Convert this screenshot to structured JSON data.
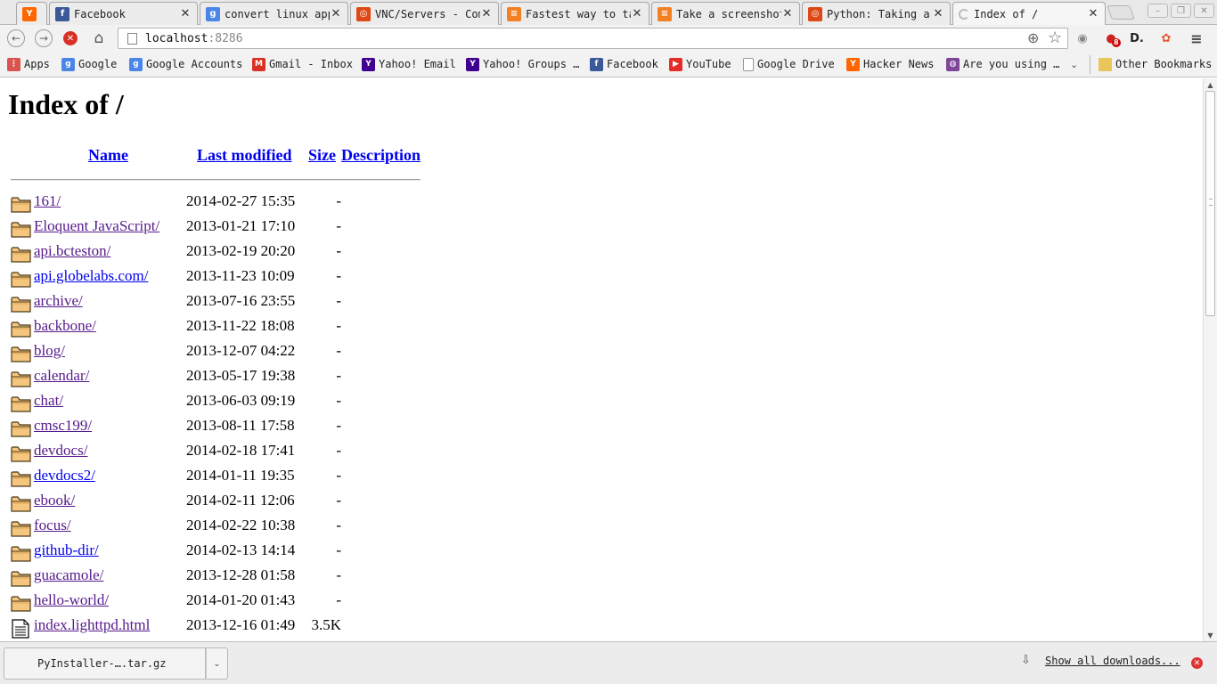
{
  "tabs": [
    {
      "title": "",
      "favicon": "ycombinator-icon",
      "color": "#ff6600",
      "letter": "Y"
    },
    {
      "title": "Facebook",
      "favicon": "facebook-icon",
      "color": "#3b5998",
      "letter": "f"
    },
    {
      "title": "convert linux app",
      "favicon": "google-icon",
      "color": "#4a86e8",
      "letter": "g"
    },
    {
      "title": "VNC/Servers - Com",
      "favicon": "ubuntu-icon",
      "color": "#dd4814",
      "letter": "◎"
    },
    {
      "title": "Fastest way to ta",
      "favicon": "stackoverflow-icon",
      "color": "#f48024",
      "letter": "≡"
    },
    {
      "title": "Take a screenshot",
      "favicon": "stackoverflow-icon",
      "color": "#f48024",
      "letter": "≡"
    },
    {
      "title": "Python: Taking a",
      "favicon": "ubuntu-icon",
      "color": "#dd4814",
      "letter": "◎"
    },
    {
      "title": "Index of /",
      "favicon": "loading-icon",
      "color": "#bbbbbb",
      "letter": ""
    }
  ],
  "toolbar": {
    "back_icon": "back-icon",
    "forward_icon": "forward-icon",
    "stop_icon": "stop-icon",
    "home_icon": "home-icon",
    "url_host": "localhost",
    "url_port": ":8286",
    "menu_icon": "menu-icon"
  },
  "extensions": [
    {
      "name": "globe-extension-icon",
      "glyph": "◉",
      "color": "#888888"
    },
    {
      "name": "notification-extension-icon",
      "glyph": "●",
      "color": "#cc2222",
      "badge": "8"
    },
    {
      "name": "d-extension-icon",
      "glyph": "D.",
      "color": "#222222"
    },
    {
      "name": "wunderlist-extension-icon",
      "glyph": "✿",
      "color": "#e4572e"
    }
  ],
  "bookmarks": [
    {
      "label": "Apps",
      "icon": "apps-icon",
      "color": "#d9534f",
      "letter": "⋮"
    },
    {
      "label": "Google",
      "icon": "google-icon",
      "color": "#4a86e8",
      "letter": "g"
    },
    {
      "label": "Google Accounts",
      "icon": "google-icon",
      "color": "#4a86e8",
      "letter": "g"
    },
    {
      "label": "Gmail - Inbox",
      "icon": "gmail-icon",
      "color": "#d93025",
      "letter": "M"
    },
    {
      "label": "Yahoo! Email",
      "icon": "yahoo-icon",
      "color": "#400191",
      "letter": "Y"
    },
    {
      "label": "Yahoo! Groups …",
      "icon": "yahoo-icon",
      "color": "#400191",
      "letter": "Y"
    },
    {
      "label": "Facebook",
      "icon": "facebook-icon",
      "color": "#3b5998",
      "letter": "f"
    },
    {
      "label": "YouTube",
      "icon": "youtube-icon",
      "color": "#e52d27",
      "letter": "▶"
    },
    {
      "label": "Google Drive",
      "icon": "page-icon",
      "color": "#bdbdbd",
      "letter": ""
    },
    {
      "label": "Hacker News",
      "icon": "ycombinator-icon",
      "color": "#ff6600",
      "letter": "Y"
    },
    {
      "label": "Are you using …",
      "icon": "tor-icon",
      "color": "#7d4698",
      "letter": "◍"
    }
  ],
  "bookmarks_more_icon": "chevron-down-icon",
  "other_bookmarks": "Other Bookmarks",
  "page": {
    "title": "Index of /",
    "headers": {
      "name": "Name",
      "modified": "Last modified",
      "size": "Size",
      "description": "Description"
    },
    "entries": [
      {
        "name": "161/",
        "modified": "2014-02-27 15:35",
        "size": "-",
        "type": "folder",
        "visited": true
      },
      {
        "name": "Eloquent JavaScript/",
        "modified": "2013-01-21 17:10",
        "size": "-",
        "type": "folder",
        "visited": true
      },
      {
        "name": "api.bcteston/",
        "modified": "2013-02-19 20:20",
        "size": "-",
        "type": "folder",
        "visited": true
      },
      {
        "name": "api.globelabs.com/",
        "modified": "2013-11-23 10:09",
        "size": "-",
        "type": "folder",
        "visited": false
      },
      {
        "name": "archive/",
        "modified": "2013-07-16 23:55",
        "size": "-",
        "type": "folder",
        "visited": true
      },
      {
        "name": "backbone/",
        "modified": "2013-11-22 18:08",
        "size": "-",
        "type": "folder",
        "visited": true
      },
      {
        "name": "blog/",
        "modified": "2013-12-07 04:22",
        "size": "-",
        "type": "folder",
        "visited": true
      },
      {
        "name": "calendar/",
        "modified": "2013-05-17 19:38",
        "size": "-",
        "type": "folder",
        "visited": true
      },
      {
        "name": "chat/",
        "modified": "2013-06-03 09:19",
        "size": "-",
        "type": "folder",
        "visited": true
      },
      {
        "name": "cmsc199/",
        "modified": "2013-08-11 17:58",
        "size": "-",
        "type": "folder",
        "visited": true
      },
      {
        "name": "devdocs/",
        "modified": "2014-02-18 17:41",
        "size": "-",
        "type": "folder",
        "visited": true
      },
      {
        "name": "devdocs2/",
        "modified": "2014-01-11 19:35",
        "size": "-",
        "type": "folder",
        "visited": false
      },
      {
        "name": "ebook/",
        "modified": "2014-02-11 12:06",
        "size": "-",
        "type": "folder",
        "visited": true
      },
      {
        "name": "focus/",
        "modified": "2014-02-22 10:38",
        "size": "-",
        "type": "folder",
        "visited": true
      },
      {
        "name": "github-dir/",
        "modified": "2014-02-13 14:14",
        "size": "-",
        "type": "folder",
        "visited": false
      },
      {
        "name": "guacamole/",
        "modified": "2013-12-28 01:58",
        "size": "-",
        "type": "folder",
        "visited": true
      },
      {
        "name": "hello-world/",
        "modified": "2014-01-20 01:43",
        "size": "-",
        "type": "folder",
        "visited": true
      },
      {
        "name": "index.lighttpd.html",
        "modified": "2013-12-16 01:49",
        "size": "3.5K",
        "type": "file",
        "visited": true
      }
    ]
  },
  "downloads": {
    "item": "PyInstaller-….tar.gz",
    "show_all": "Show all downloads...",
    "close_icon": "close-icon"
  }
}
